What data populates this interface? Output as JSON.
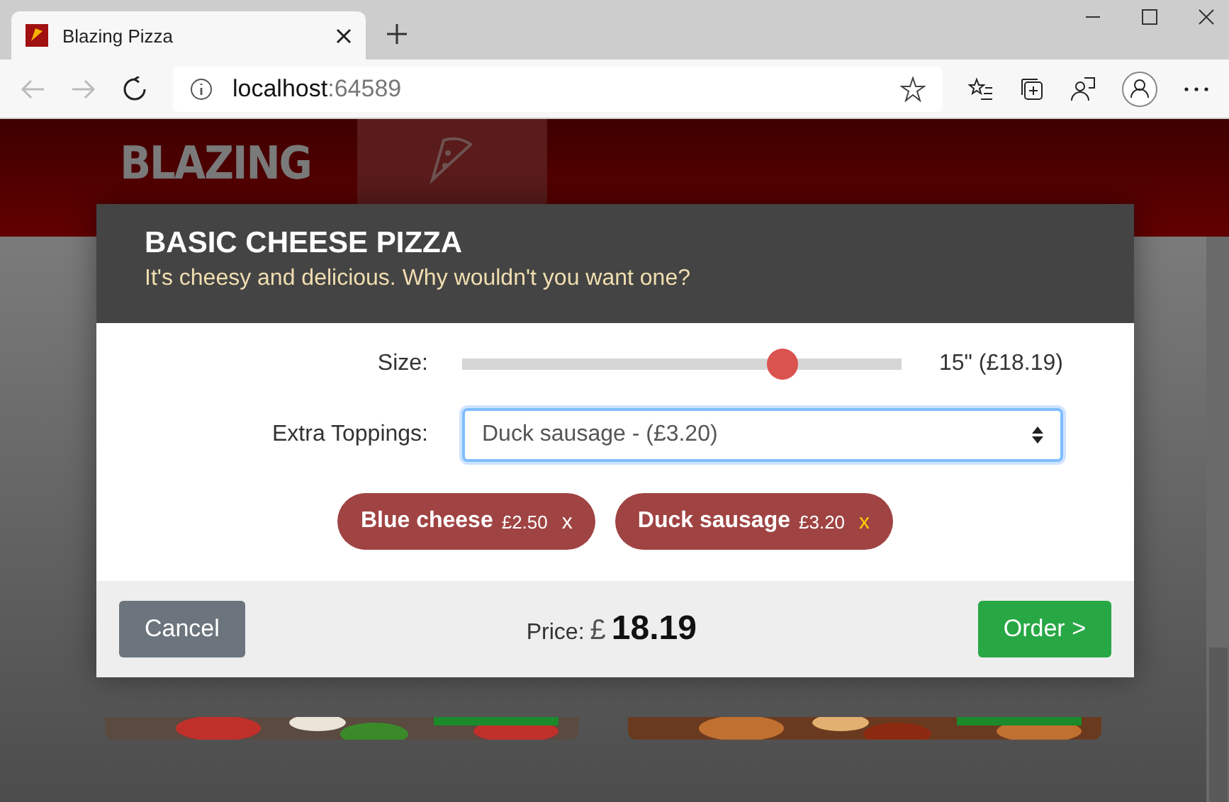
{
  "browser": {
    "tab_title": "Blazing Pizza",
    "address_host": "localhost",
    "address_port": ":64589"
  },
  "site": {
    "logo": "BLAZING",
    "nav": [
      {
        "selected": true
      }
    ]
  },
  "dialog": {
    "title": "BASIC CHEESE PIZZA",
    "subtitle": "It's cheesy and delicious. Why wouldn't you want one?",
    "size_label": "Size:",
    "size_slider": {
      "level": 0.73
    },
    "size_value": "15\" (£18.19)",
    "toppings_label": "Extra Toppings:",
    "toppings_value": "Duck sausage - (£3.20)",
    "toppings": [
      {
        "name": "Blue cheese",
        "price": "£2.50",
        "remove": "x",
        "highlighted": false
      },
      {
        "name": "Duck sausage",
        "price": "£3.20",
        "remove": "x",
        "highlighted": true
      }
    ],
    "cancel": "Cancel",
    "price_label": "Price:",
    "currency": "£",
    "price": "18.19",
    "order": "Order >"
  }
}
